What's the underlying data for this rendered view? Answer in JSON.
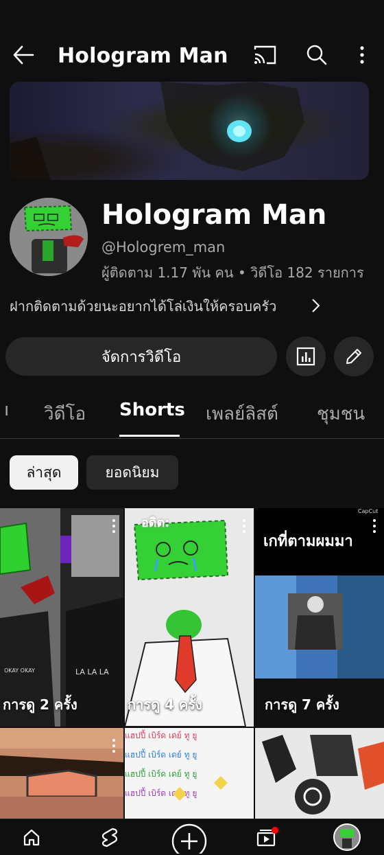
{
  "header": {
    "title": "Hologram Man",
    "icons": [
      "back-arrow-icon",
      "cast-icon",
      "search-icon",
      "more-vert-icon"
    ]
  },
  "channel": {
    "name": "Hologram Man",
    "handle": "@Hologrem_man",
    "stats": "ผู้ติดตาม 1.17 พัน คน • วิดีโอ 182 รายการ",
    "description": "ฝากติดตามด้วยนะอยากได้โล่เงินให้ครอบครัว"
  },
  "actions": {
    "manage_label": "จัดการวิดีโอ",
    "icons": [
      "analytics-icon",
      "edit-pencil-icon"
    ]
  },
  "tabs": [
    {
      "label": "ı",
      "active": false
    },
    {
      "label": "วิดีโอ",
      "active": false
    },
    {
      "label": "Shorts",
      "active": true
    },
    {
      "label": "เพลย์ลิสต์",
      "active": false
    },
    {
      "label": "ชุมชน",
      "active": false
    }
  ],
  "chips": [
    {
      "label": "ล่าสุด",
      "selected": true
    },
    {
      "label": "ยอดนิยม",
      "selected": false
    }
  ],
  "shorts": [
    {
      "views": "การดู 2 ครั้ง",
      "overlay": "",
      "captions": [
        "OKAY OKAY",
        "LA LA LA"
      ]
    },
    {
      "views": "การดู 4 ครั้ง",
      "overlay": "อดิต:",
      "captions": []
    },
    {
      "views": "การดู 7 ครั้ง",
      "overlay": "เกที่ตามผมมา",
      "captions": [
        "CapCut"
      ]
    },
    {
      "views": "",
      "overlay": "",
      "captions": []
    },
    {
      "views": "",
      "overlay": "",
      "captions": [
        "แฮปปี้ เบิร์ด เดย์ ทู ยู"
      ]
    },
    {
      "views": "",
      "overlay": "",
      "captions": []
    }
  ],
  "bottom_nav": [
    "home-icon",
    "shorts-icon",
    "create-plus-icon",
    "subscriptions-icon",
    "profile-avatar-icon"
  ],
  "colors": {
    "background": "#0f0f0f",
    "chip_selected": "#f1f1f1",
    "button_bg": "#272727",
    "notification_dot": "#ff0000"
  }
}
